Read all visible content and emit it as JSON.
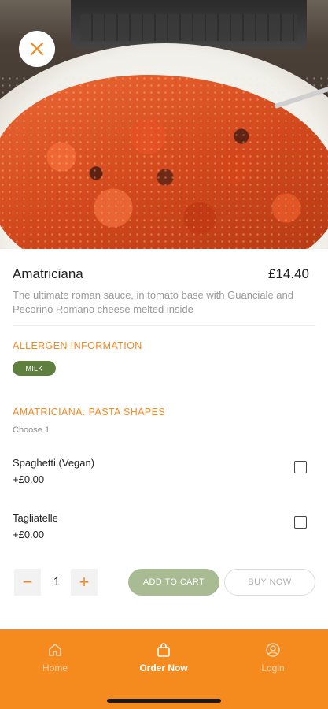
{
  "product": {
    "name": "Amatriciana",
    "price": "£14.40",
    "description": "The ultimate roman sauce, in tomato base with Guanciale and Pecorino Romano cheese melted inside"
  },
  "allergens": {
    "heading": "ALLERGEN INFORMATION",
    "items": [
      "MILK"
    ]
  },
  "pasta_shapes": {
    "heading": "AMATRICIANA: PASTA SHAPES",
    "hint": "Choose 1",
    "options": [
      {
        "name": "Spaghetti (Vegan)",
        "price": "+£0.00",
        "checked": false
      },
      {
        "name": "Tagliatelle",
        "price": "+£0.00",
        "checked": false
      }
    ]
  },
  "quantity": {
    "value": "1",
    "minus": "−",
    "plus": "+"
  },
  "actions": {
    "add_to_cart": "ADD TO CART",
    "buy_now": "BUY NOW"
  },
  "tabbar": {
    "tabs": [
      {
        "label": "Home",
        "icon": "home-icon"
      },
      {
        "label": "Order Now",
        "icon": "bag-icon",
        "active": true
      },
      {
        "label": "Login",
        "icon": "user-icon"
      }
    ]
  },
  "colors": {
    "accent": "#f08a24",
    "tabbar": "#f58a1f",
    "allergen_badge": "#5f7f3e",
    "add_to_cart": "#a8bb93"
  }
}
